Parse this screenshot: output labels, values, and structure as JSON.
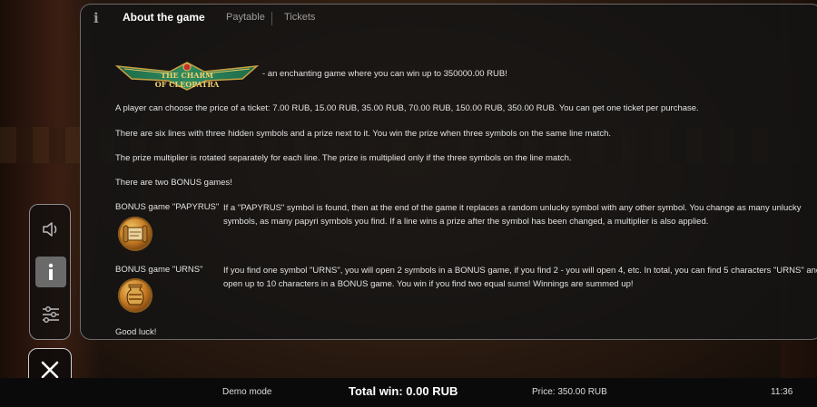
{
  "tabs": [
    {
      "label": "About the game",
      "active": true
    },
    {
      "label": "Paytable",
      "active": false
    },
    {
      "label": "Tickets",
      "active": false
    }
  ],
  "info_glyph": "i",
  "logo_text": "The Charm of Cleopatra",
  "tagline": "- an enchanting game where you can win up to 350000.00 RUB!",
  "paragraphs": [
    "A player can choose the price of a ticket: 7.00 RUB, 15.00 RUB, 35.00 RUB, 70.00 RUB, 150.00 RUB, 350.00 RUB. You can get one ticket per purchase.",
    "There are six lines with three hidden symbols and a prize next to it. You win the prize when three symbols on the same line match.",
    "The prize multiplier is rotated separately for each line. The prize is multiplied only if the three symbols on the line match.",
    "There are two BONUS games!"
  ],
  "bonus": [
    {
      "label": "BONUS game \"PAPYRUS\"",
      "text": "If a \"PAPYRUS\" symbol is found, then at the end of the game it replaces a random unlucky symbol with any other symbol. You change as many unlucky symbols, as many papyri symbols you find. If a line wins a prize after the symbol has been changed, a multiplier is also applied.",
      "icon": "papyrus-icon"
    },
    {
      "label": "BONUS game \"URNS\"",
      "text": "If you find one symbol \"URNS\", you will open 2 symbols in a BONUS game, if you find 2 - you will open 4, etc. In total, you can find 5 characters \"URNS\" and open up to 10 characters in a BONUS game. You win if you find two equal sums! Winnings are summed up!",
      "icon": "urn-icon"
    }
  ],
  "closing": "Good luck!",
  "side_buttons": [
    "sound-icon",
    "info-icon",
    "settings-sliders-icon"
  ],
  "bottom": {
    "mode": "Demo mode",
    "total_win": "Total win: 0.00 RUB",
    "price": "Price: 350.00 RUB",
    "time": "11:36"
  },
  "colors": {
    "panel_bg": "#141414",
    "text": "#e2e2e2",
    "tab_inactive": "#9c9c9c",
    "gold": "#c8a040",
    "bottom_bar": "#0a0a0a"
  }
}
